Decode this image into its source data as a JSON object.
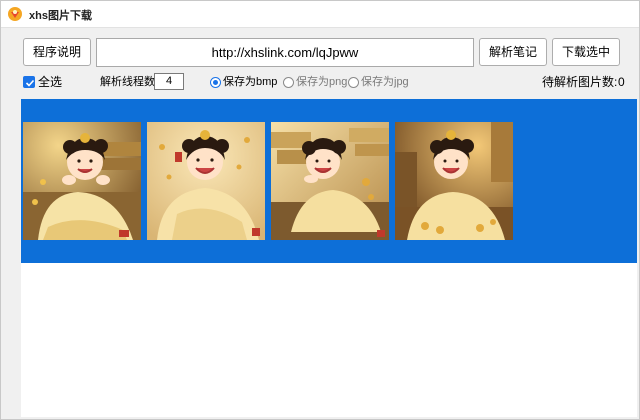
{
  "window": {
    "title": "xhs图片下载"
  },
  "toolbar": {
    "help_label": "程序说明",
    "url_value": "http://xhslink.com/lqJpww",
    "parse_label": "解析笔记",
    "download_label": "下载选中"
  },
  "options": {
    "select_all_label": "全选",
    "select_all_checked": true,
    "threads_label": "解析线程数:",
    "threads_value": "4",
    "save_formats": [
      {
        "label": "保存为bmp",
        "selected": true
      },
      {
        "label": "保存为png",
        "selected": false
      },
      {
        "label": "保存为jpg",
        "selected": false
      }
    ],
    "pending_label": "待解析图片数:",
    "pending_count": "0"
  },
  "gallery": {
    "background": "#0d6fd8",
    "images": [
      {
        "name": "thumbnail-1"
      },
      {
        "name": "thumbnail-2"
      },
      {
        "name": "thumbnail-3"
      },
      {
        "name": "thumbnail-4"
      }
    ]
  }
}
